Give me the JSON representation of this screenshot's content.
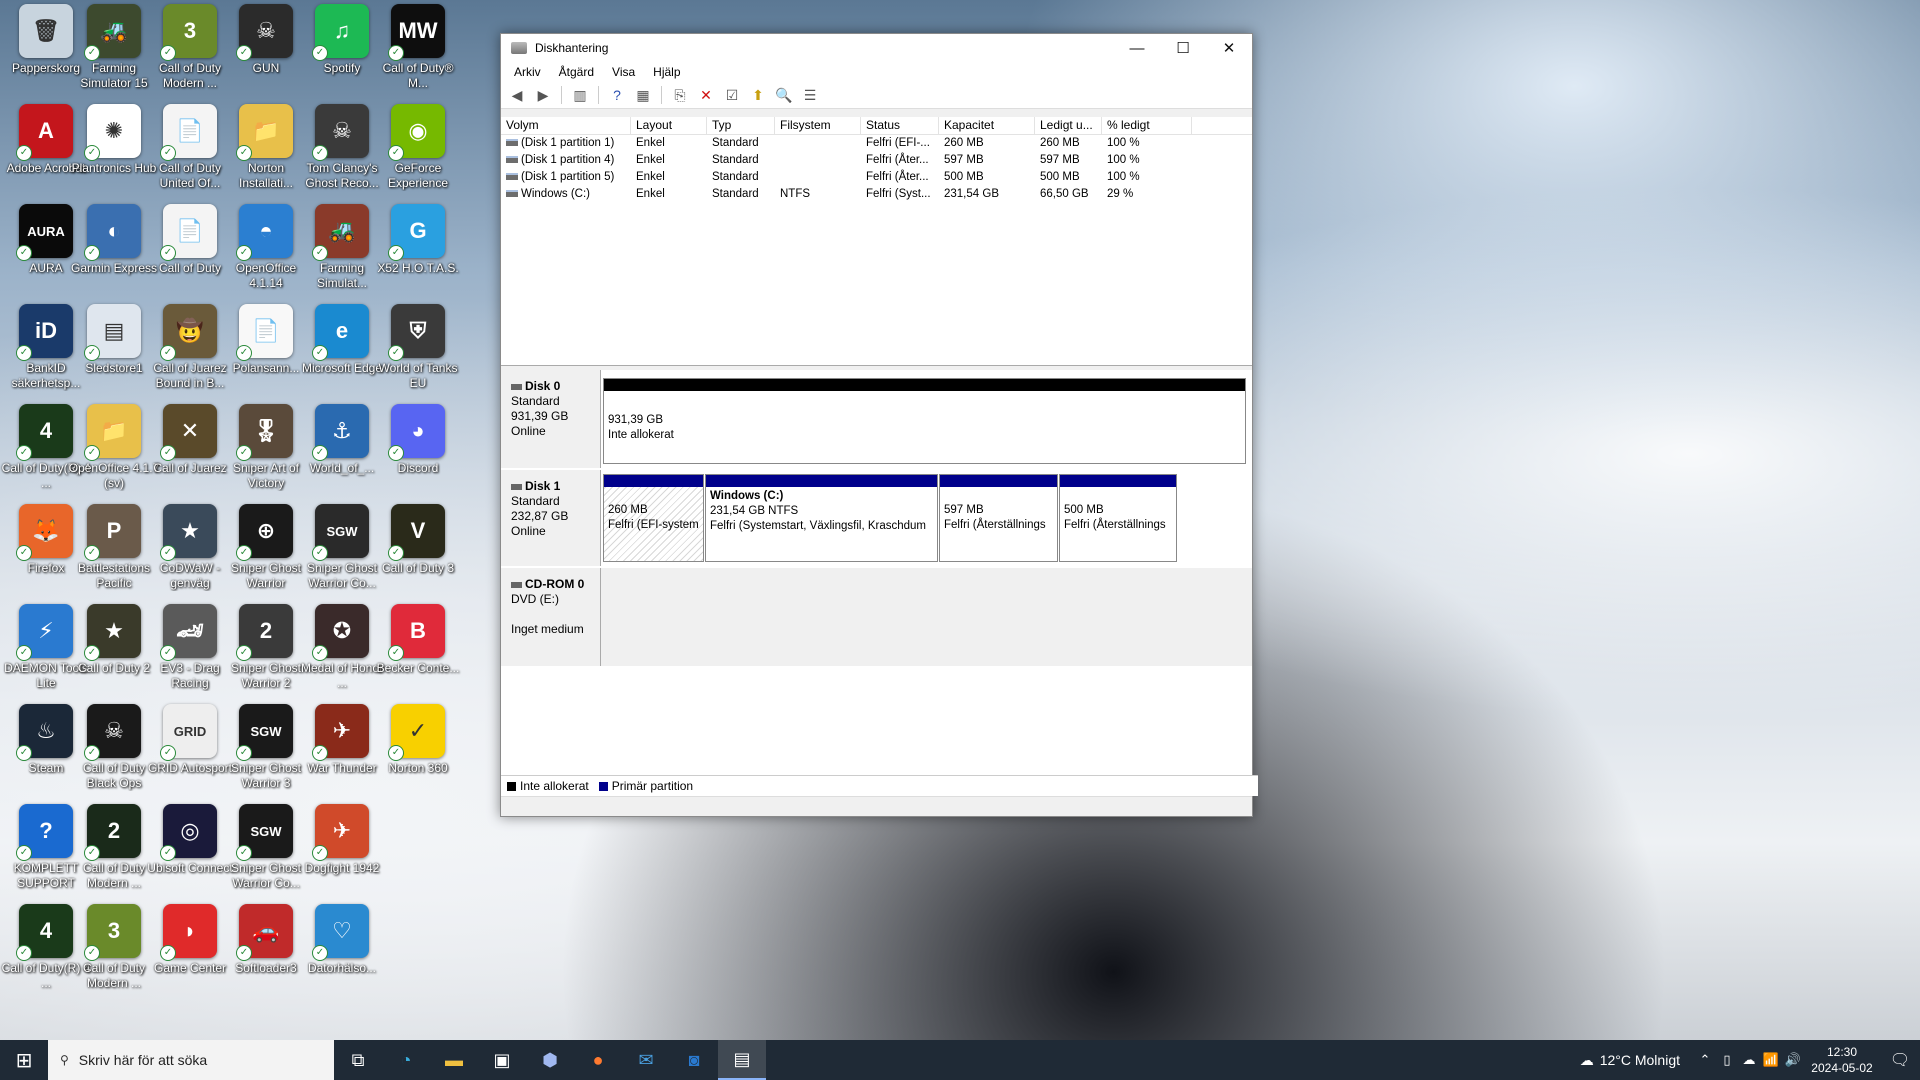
{
  "desktop": {
    "icons": [
      {
        "label": "Papperskorg",
        "color": "#c8d4de",
        "glyph": "🗑"
      },
      {
        "label": "Farming Simulator 15",
        "color": "#3d4a2e",
        "glyph": "🚜"
      },
      {
        "label": "Call of Duty Modern ...",
        "color": "#6a8a2a",
        "glyph": "3"
      },
      {
        "label": "GUN",
        "color": "#2b2b2b",
        "glyph": "☠"
      },
      {
        "label": "Spotify",
        "color": "#1db954",
        "glyph": "♫"
      },
      {
        "label": "Call of Duty® M...",
        "color": "#0e0e0e",
        "glyph": "MW"
      },
      {
        "label": "Adobe Acrobat",
        "color": "#c4161c",
        "glyph": "A"
      },
      {
        "label": "Plantronics Hub",
        "color": "#ffffff",
        "glyph": "✺"
      },
      {
        "label": "Call of Duty United Of...",
        "color": "#f4f4f4",
        "glyph": "📄"
      },
      {
        "label": "Norton Installati...",
        "color": "#e8c04a",
        "glyph": "📁"
      },
      {
        "label": "Tom Clancy's Ghost Reco...",
        "color": "#3a3a3a",
        "glyph": "☠"
      },
      {
        "label": "GeForce Experience",
        "color": "#76b900",
        "glyph": "◉"
      },
      {
        "label": "AURA",
        "color": "#0a0a0a",
        "glyph": "AURA"
      },
      {
        "label": "Garmin Express",
        "color": "#3a6fb0",
        "glyph": "◐"
      },
      {
        "label": "Call of Duty",
        "color": "#f4f4f4",
        "glyph": "📄"
      },
      {
        "label": "OpenOffice 4.1.14",
        "color": "#2b7fd1",
        "glyph": "◓"
      },
      {
        "label": "Farming Simulat...",
        "color": "#8a3a2a",
        "glyph": "🚜"
      },
      {
        "label": "X52 H.O.T.A.S.",
        "color": "#2aa0e0",
        "glyph": "G"
      },
      {
        "label": "BankID säkerhetsp...",
        "color": "#1a3a6a",
        "glyph": "iD"
      },
      {
        "label": "Sledstore1",
        "color": "#dfe6ee",
        "glyph": "▤"
      },
      {
        "label": "Call of Juarez Bound in B...",
        "color": "#6a5a3a",
        "glyph": "🤠"
      },
      {
        "label": "Polansann...",
        "color": "#f8f8f8",
        "glyph": "📄"
      },
      {
        "label": "Microsoft Edge",
        "color": "#1a8ad0",
        "glyph": "e"
      },
      {
        "label": "World of Tanks EU",
        "color": "#3a3a3a",
        "glyph": "⛨"
      },
      {
        "label": "Call of Duty(R) 4 ...",
        "color": "#1a3a1a",
        "glyph": "4"
      },
      {
        "label": "OpenOffice 4.1.7 (sv)",
        "color": "#e8c04a",
        "glyph": "📁"
      },
      {
        "label": "Call of Juarez",
        "color": "#5a4a2a",
        "glyph": "✕"
      },
      {
        "label": "Sniper Art of Victory",
        "color": "#5a4a3a",
        "glyph": "🎖"
      },
      {
        "label": "World_of_...",
        "color": "#2a6ab0",
        "glyph": "⚓"
      },
      {
        "label": "Discord",
        "color": "#5865f2",
        "glyph": "◕"
      },
      {
        "label": "Firefox",
        "color": "#e8662a",
        "glyph": "🦊"
      },
      {
        "label": "Battlestations Pacific",
        "color": "#6a5a4a",
        "glyph": "P"
      },
      {
        "label": "CoDWaW - genväg",
        "color": "#3a4a5a",
        "glyph": "★"
      },
      {
        "label": "Sniper Ghost Warrior",
        "color": "#1a1a1a",
        "glyph": "⊕"
      },
      {
        "label": "Sniper Ghost Warrior Co...",
        "color": "#2a2a2a",
        "glyph": "SGW"
      },
      {
        "label": "Call of Duty 3",
        "color": "#2a2a1a",
        "glyph": "V"
      },
      {
        "label": "DAEMON Tools Lite",
        "color": "#2a7ad0",
        "glyph": "⚡"
      },
      {
        "label": "Call of Duty 2",
        "color": "#3a3a2a",
        "glyph": "★"
      },
      {
        "label": "EV3 - Drag Racing",
        "color": "#5a5a5a",
        "glyph": "🏎"
      },
      {
        "label": "Sniper Ghost Warrior 2",
        "color": "#3a3a3a",
        "glyph": "2"
      },
      {
        "label": "Medal of Honor ...",
        "color": "#3a2a2a",
        "glyph": "✪"
      },
      {
        "label": "Becker Conte...",
        "color": "#e02a3a",
        "glyph": "B"
      },
      {
        "label": "Steam",
        "color": "#1b2838",
        "glyph": "♨"
      },
      {
        "label": "Call of Duty Black Ops",
        "color": "#1a1a1a",
        "glyph": "☠"
      },
      {
        "label": "GRID Autosport",
        "color": "#eeeeee",
        "glyph": "GRID"
      },
      {
        "label": "Sniper Ghost Warrior 3",
        "color": "#1a1a1a",
        "glyph": "SGW"
      },
      {
        "label": "War Thunder",
        "color": "#8a2a1a",
        "glyph": "✈"
      },
      {
        "label": "Norton 360",
        "color": "#f8d000",
        "glyph": "✓"
      },
      {
        "label": "KOMPLETT SUPPORT",
        "color": "#1a6ad0",
        "glyph": "?"
      },
      {
        "label": "Call of Duty Modern ...",
        "color": "#1a2a1a",
        "glyph": "2"
      },
      {
        "label": "Ubisoft Connect",
        "color": "#1a1a3a",
        "glyph": "◎"
      },
      {
        "label": "Sniper Ghost Warrior Co...",
        "color": "#1a1a1a",
        "glyph": "SGW"
      },
      {
        "label": "Dogfight 1942",
        "color": "#d04a2a",
        "glyph": "✈"
      },
      {
        "label": "Call of Duty(R) 4 ...",
        "color": "#1a3a1a",
        "glyph": "4"
      },
      {
        "label": "Call of Duty Modern ...",
        "color": "#6a8a2a",
        "glyph": "3"
      },
      {
        "label": "Game Center",
        "color": "#e02a2a",
        "glyph": "◗"
      },
      {
        "label": "Softloader3",
        "color": "#c02a2a",
        "glyph": "🚗"
      },
      {
        "label": "Datorhälso...",
        "color": "#2a8ad0",
        "glyph": "♡"
      }
    ]
  },
  "window": {
    "title": "Diskhantering",
    "controls": {
      "minimize": "—",
      "maximize": "☐",
      "close": "✕"
    },
    "menu": [
      "Arkiv",
      "Åtgärd",
      "Visa",
      "Hjälp"
    ],
    "table": {
      "columns": [
        "Volym",
        "Layout",
        "Typ",
        "Filsystem",
        "Status",
        "Kapacitet",
        "Ledigt u...",
        "% ledigt"
      ],
      "rows": [
        [
          "(Disk 1 partition 1)",
          "Enkel",
          "Standard",
          "",
          "Felfri (EFI-...",
          "260 MB",
          "260 MB",
          "100 %"
        ],
        [
          "(Disk 1 partition 4)",
          "Enkel",
          "Standard",
          "",
          "Felfri (Åter...",
          "597 MB",
          "597 MB",
          "100 %"
        ],
        [
          "(Disk 1 partition 5)",
          "Enkel",
          "Standard",
          "",
          "Felfri (Åter...",
          "500 MB",
          "500 MB",
          "100 %"
        ],
        [
          "Windows (C:)",
          "Enkel",
          "Standard",
          "NTFS",
          "Felfri (Syst...",
          "231,54 GB",
          "66,50 GB",
          "29 %"
        ]
      ]
    },
    "disks": [
      {
        "name": "Disk 0",
        "type": "Standard",
        "size": "931,39 GB",
        "state": "Online",
        "partitions": [
          {
            "title": "",
            "size": "931,39 GB",
            "status": "Inte allokerat"
          }
        ]
      },
      {
        "name": "Disk 1",
        "type": "Standard",
        "size": "232,87 GB",
        "state": "Online",
        "partitions": [
          {
            "title": "",
            "size": "260 MB",
            "status": "Felfri (EFI-system"
          },
          {
            "title": "Windows  (C:)",
            "size": "231,54 GB NTFS",
            "status": "Felfri (Systemstart, Växlingsfil, Kraschdum"
          },
          {
            "title": "",
            "size": "597 MB",
            "status": "Felfri (Återställnings"
          },
          {
            "title": "",
            "size": "500 MB",
            "status": "Felfri (Återställnings"
          }
        ]
      },
      {
        "name": "CD-ROM 0",
        "type": "DVD (E:)",
        "size": "",
        "state": "Inget medium",
        "partitions": []
      }
    ],
    "legend": [
      {
        "label": "Inte allokerat",
        "color": "#000000"
      },
      {
        "label": "Primär partition",
        "color": "#00008b"
      }
    ]
  },
  "taskbar": {
    "search_placeholder": "Skriv här för att söka",
    "weather": "12°C  Molnigt",
    "time": "12:30",
    "date": "2024-05-02"
  },
  "colors": {
    "unallocated": "#000000",
    "primary": "#00008b",
    "taskbar": "#1f2a36"
  }
}
